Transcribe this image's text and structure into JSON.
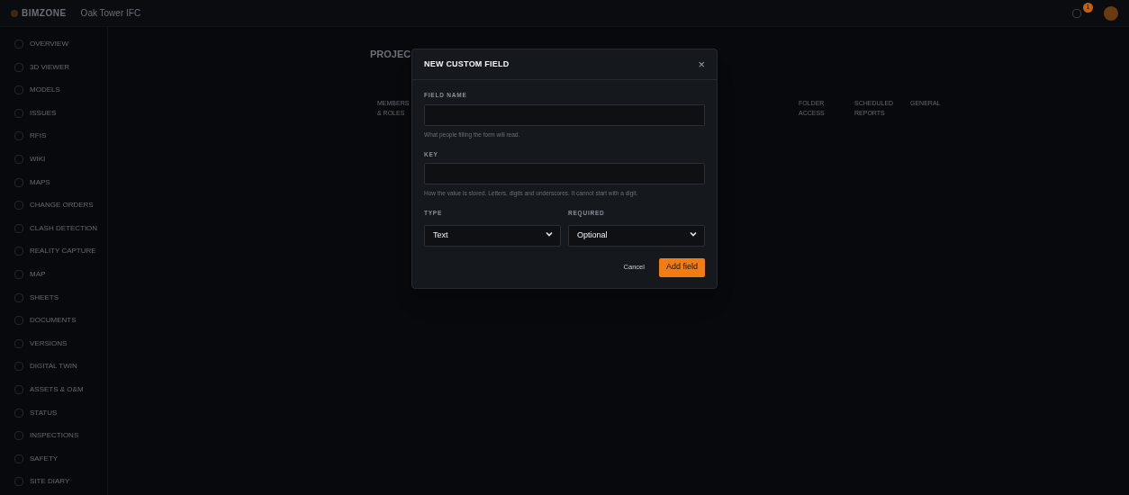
{
  "header": {
    "brand": "BIMZONE",
    "project": "Oak Tower IFC",
    "notification_count": "1"
  },
  "sidebar": {
    "items": [
      {
        "label": "OVERVIEW"
      },
      {
        "label": "3D VIEWER"
      },
      {
        "label": "MODELS"
      },
      {
        "label": "ISSUES"
      },
      {
        "label": "RFIS"
      },
      {
        "label": "WIKI"
      },
      {
        "label": "MAPS"
      },
      {
        "label": "CHANGE ORDERS"
      },
      {
        "label": "CLASH DETECTION"
      },
      {
        "label": "REALITY CAPTURE"
      },
      {
        "label": "MAP"
      },
      {
        "label": "SHEETS"
      },
      {
        "label": "DOCUMENTS"
      },
      {
        "label": "VERSIONS"
      },
      {
        "label": "DIGITAL TWIN"
      },
      {
        "label": "ASSETS & O&M"
      },
      {
        "label": "STATUS"
      },
      {
        "label": "INSPECTIONS"
      },
      {
        "label": "SAFETY"
      },
      {
        "label": "SITE DIARY"
      }
    ]
  },
  "page": {
    "title": "PROJEC",
    "tabs": [
      {
        "label": "MEMBERS & ROLES"
      },
      {
        "label": "FOLDER ACCESS"
      },
      {
        "label": "SCHEDULED REPORTS"
      },
      {
        "label": "GENERAL"
      }
    ]
  },
  "dialog": {
    "title": "NEW CUSTOM FIELD",
    "close": "×",
    "fields": [
      {
        "kind": "text",
        "label": "FIELD NAME",
        "hint": "What people filling the form will read."
      },
      {
        "kind": "text",
        "label": "KEY",
        "hint": "How the value is stored. Letters, digits and underscores. It cannot start with a digit."
      }
    ],
    "selects": [
      {
        "label": "TYPE",
        "value": "Text"
      },
      {
        "label": "REQUIRED",
        "value": "Optional"
      }
    ],
    "buttons": [
      {
        "kind": "secondary",
        "label": "Cancel"
      },
      {
        "kind": "primary",
        "label": "Add field"
      }
    ]
  }
}
